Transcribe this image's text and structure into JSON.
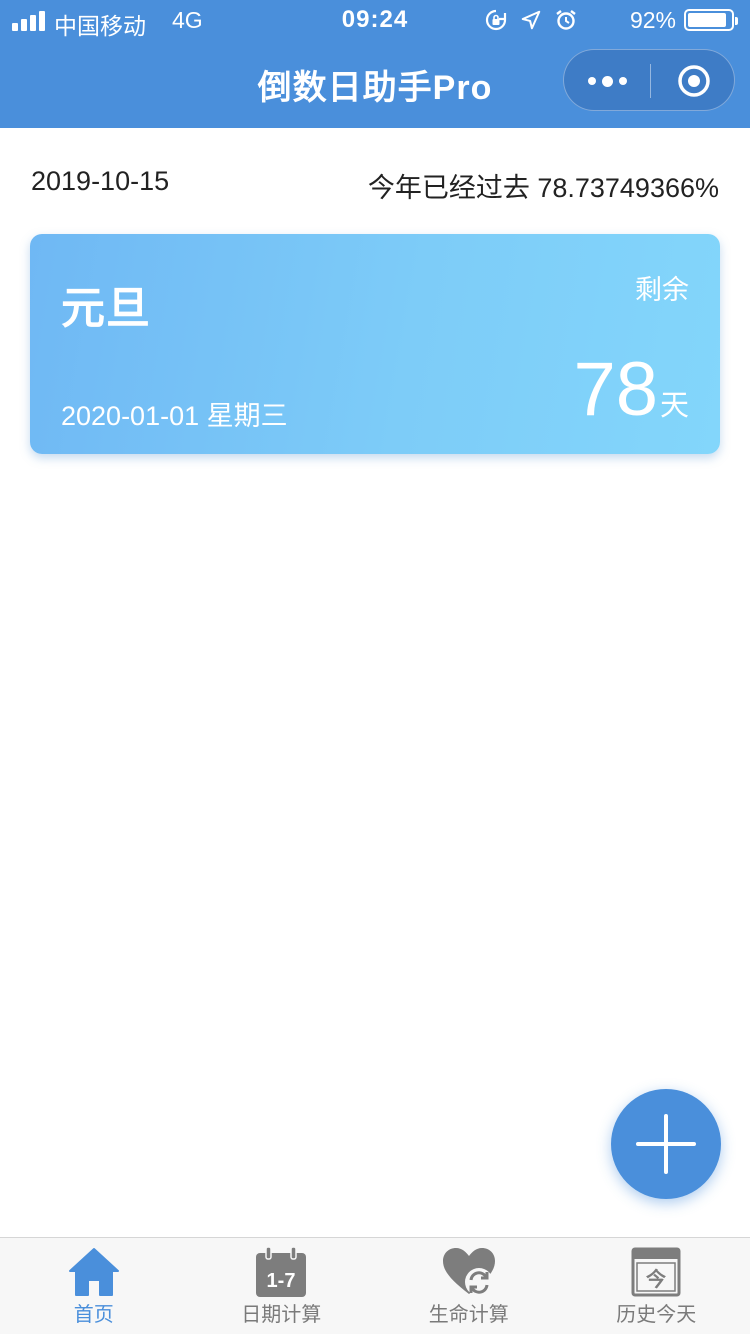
{
  "status_bar": {
    "carrier": "中国移动",
    "network": "4G",
    "time": "09:24",
    "battery_percent": "92%",
    "battery_level": 0.92
  },
  "nav": {
    "title": "倒数日助手Pro"
  },
  "info": {
    "today": "2019-10-15",
    "year_progress": "今年已经过去 78.73749366%"
  },
  "countdown_card": {
    "title": "元旦",
    "remaining_label": "剩余",
    "target_date": "2020-01-01 星期三",
    "days": "78",
    "unit": "天"
  },
  "tabs": [
    {
      "label": "首页",
      "icon": "home-icon",
      "active": true
    },
    {
      "label": "日期计算",
      "icon": "calendar-1-7-icon",
      "calendar_text": "1-7",
      "active": false
    },
    {
      "label": "生命计算",
      "icon": "heart-refresh-icon",
      "active": false
    },
    {
      "label": "历史今天",
      "icon": "calendar-today-icon",
      "calendar_text": "今",
      "active": false
    }
  ],
  "colors": {
    "primary": "#4a8fdb",
    "card_start": "#6fb8f4",
    "card_end": "#83d6fb",
    "tab_inactive": "#7a7a7a"
  }
}
